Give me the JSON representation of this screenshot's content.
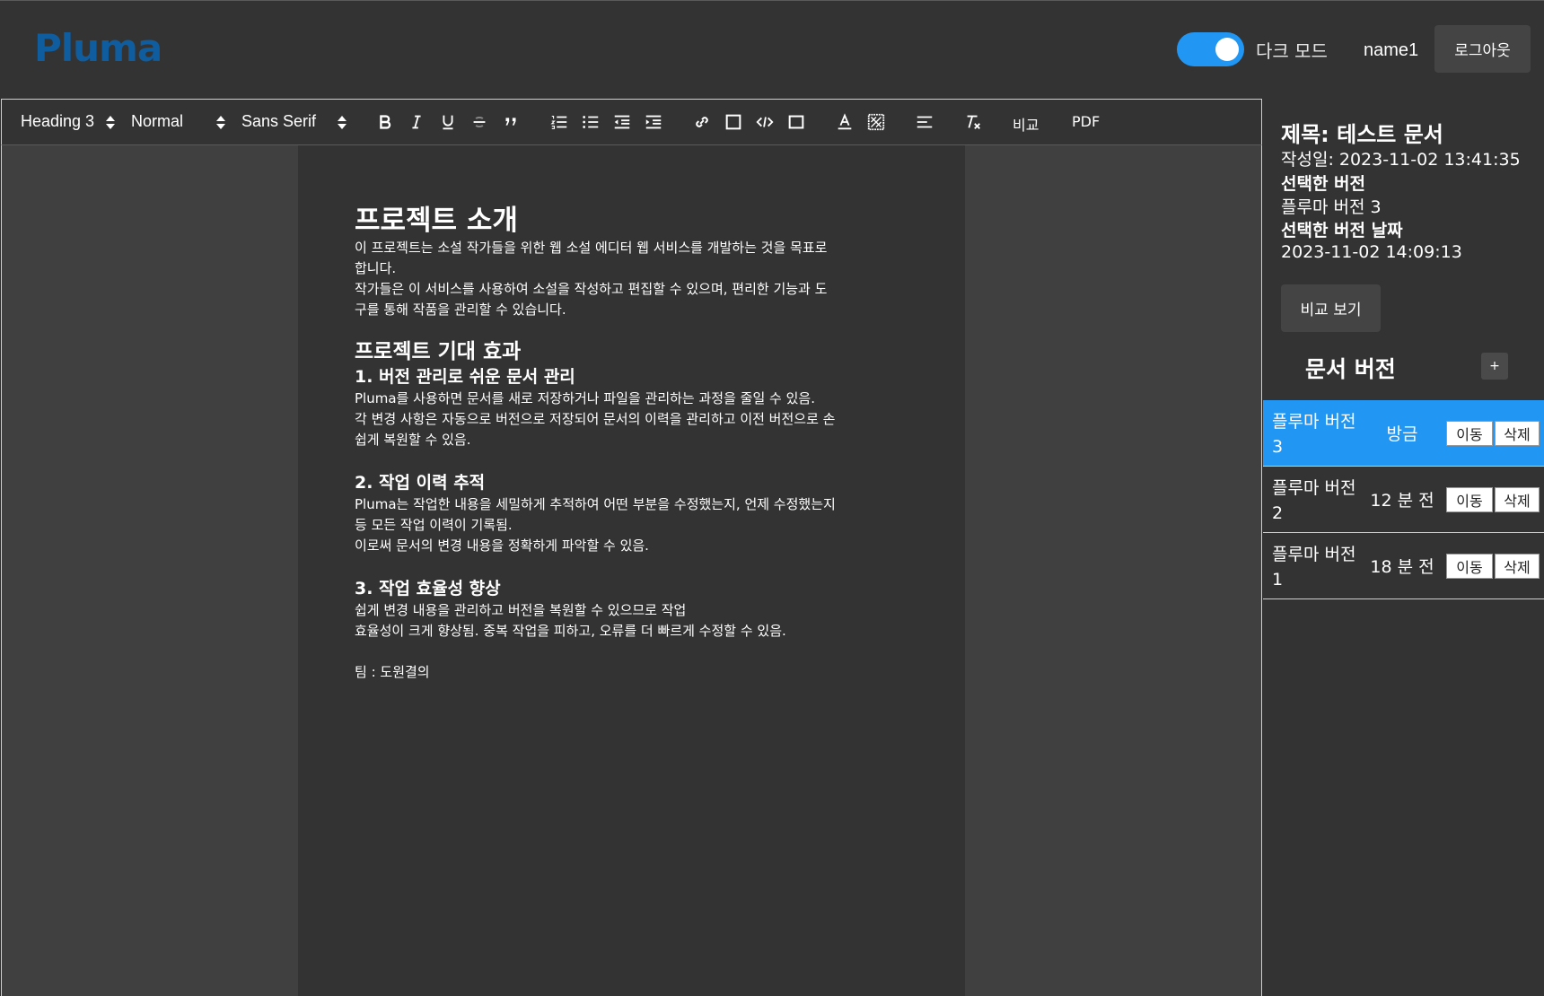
{
  "header": {
    "logo": "Pluma",
    "dark_mode_label": "다크 모드",
    "dark_mode_on": true,
    "username": "name1",
    "logout_label": "로그아웃"
  },
  "toolbar": {
    "heading_select": "Heading 3",
    "size_select": "Normal",
    "font_select": "Sans Serif",
    "compare_label": "비교",
    "pdf_label": "PDF"
  },
  "document": {
    "title": "프로젝트 소개",
    "intro_1": "이 프로젝트는 소설 작가들을 위한 웹 소설 에디터 웹 서비스를 개발하는 것을 목표로",
    "intro_2": "합니다.",
    "intro_3": "작가들은 이 서비스를 사용하여 소설을 작성하고 편집할 수 있으며, 편리한 기능과 도",
    "intro_4": "구를 통해 작품을 관리할 수 있습니다.",
    "effects_heading": "프로젝트 기대 효과",
    "s1_title": "1. 버전 관리로 쉬운 문서 관리",
    "s1_l1": "Pluma를 사용하면 문서를 새로 저장하거나 파일을 관리하는 과정을 줄일 수 있음.",
    "s1_l2": "각 변경 사항은 자동으로 버전으로 저장되어 문서의 이력을 관리하고 이전 버전으로 손",
    "s1_l3": "쉽게 복원할 수 있음.",
    "s2_title": "2. 작업 이력 추적",
    "s2_l1": "Pluma는 작업한 내용을 세밀하게 추적하여 어떤 부분을 수정했는지, 언제 수정했는지",
    "s2_l2": "등 모든 작업 이력이 기록됨.",
    "s2_l3": "이로써 문서의 변경 내용을 정확하게 파악할 수 있음.",
    "s3_title": "3. 작업 효율성 향상",
    "s3_l1": "쉽게 변경 내용을 관리하고 버전을 복원할 수 있으므로 작업",
    "s3_l2": "효율성이 크게 향상됨. 중복 작업을 피하고, 오류를 더 빠르게 수정할 수 있음.",
    "team": "팀 : 도원결의"
  },
  "panel": {
    "title": "제목: 테스트 문서",
    "created": "작성일: 2023-11-02 13:41:35",
    "selected_version_label": "선택한 버전",
    "selected_version": "플루마 버전 3",
    "selected_date_label": "선택한 버전 날짜",
    "selected_date": "2023-11-02 14:09:13",
    "compare_button": "비교 보기",
    "versions_title": "문서 버전",
    "add_button": "+",
    "versions": [
      {
        "name": "플루마 버전 3",
        "time": "방금",
        "move": "이동",
        "delete": "삭제"
      },
      {
        "name": "플루마 버전 2",
        "time": "12 분 전",
        "move": "이동",
        "delete": "삭제"
      },
      {
        "name": "플루마 버전 1",
        "time": "18 분 전",
        "move": "이동",
        "delete": "삭제"
      }
    ]
  },
  "colors": {
    "accent": "#2196f3",
    "logo": "#0f5c9e",
    "background": "#333333",
    "editor_margin": "#404040"
  },
  "icons": [
    "bold-icon",
    "italic-icon",
    "underline-icon",
    "strike-icon",
    "blockquote-icon",
    "ordered-list-icon",
    "bullet-list-icon",
    "outdent-icon",
    "indent-icon",
    "link-icon",
    "image-icon",
    "code-block-icon",
    "video-icon",
    "text-color-icon",
    "background-color-icon",
    "align-icon",
    "clear-format-icon"
  ]
}
